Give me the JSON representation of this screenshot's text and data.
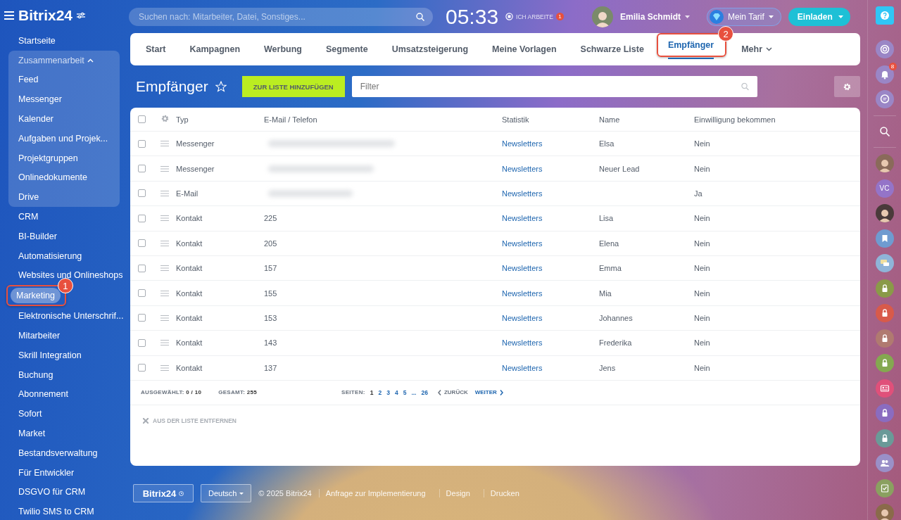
{
  "sidebar": {
    "logo": "Bitrix24",
    "items": [
      {
        "label": "Startseite",
        "kind": "link",
        "selected": false
      },
      {
        "label": "Zusammenarbeit",
        "kind": "group",
        "selected": false,
        "expanded": true,
        "children": [
          {
            "label": "Feed",
            "selected": false
          },
          {
            "label": "Messenger",
            "selected": false
          },
          {
            "label": "Kalender",
            "selected": false
          },
          {
            "label": "Aufgaben und Projek...",
            "selected": false
          },
          {
            "label": "Projektgruppen",
            "selected": false
          },
          {
            "label": "Onlinedokumente",
            "selected": false
          },
          {
            "label": "Drive",
            "selected": false
          }
        ]
      },
      {
        "label": "CRM",
        "kind": "link",
        "selected": false
      },
      {
        "label": "BI-Builder",
        "kind": "link",
        "selected": false
      },
      {
        "label": "Automatisierung",
        "kind": "link",
        "selected": false
      },
      {
        "label": "Websites und Onlineshops",
        "kind": "link",
        "selected": false
      },
      {
        "label": "Marketing",
        "kind": "link",
        "selected": true,
        "callout": "1"
      },
      {
        "label": "Elektronische Unterschrif...",
        "kind": "link",
        "selected": false
      },
      {
        "label": "Mitarbeiter",
        "kind": "link",
        "selected": false
      },
      {
        "label": "Skrill Integration",
        "kind": "link",
        "selected": false
      },
      {
        "label": "Buchung",
        "kind": "link",
        "selected": false
      },
      {
        "label": "Abonnement",
        "kind": "link",
        "selected": false
      },
      {
        "label": "Sofort",
        "kind": "link",
        "selected": false
      },
      {
        "label": "Market",
        "kind": "link",
        "selected": false
      },
      {
        "label": "Bestandsverwaltung",
        "kind": "link",
        "selected": false
      },
      {
        "label": "Für Entwickler",
        "kind": "link",
        "selected": false
      },
      {
        "label": "DSGVO für CRM",
        "kind": "link",
        "selected": false
      },
      {
        "label": "Twilio SMS to CRM",
        "kind": "link",
        "selected": false
      }
    ]
  },
  "header": {
    "search_placeholder": "Suchen nach: Mitarbeiter, Datei, Sonstiges...",
    "clock": "05:33",
    "work_status": "ICH ARBEITE",
    "work_badge": "1",
    "user": "Emilia Schmidt",
    "plan_button": "Mein Tarif",
    "invite_button": "Einladen"
  },
  "tabs": [
    {
      "label": "Start",
      "kind": "tab",
      "selected": false
    },
    {
      "label": "Kampagnen",
      "kind": "tab",
      "selected": false
    },
    {
      "label": "Werbung",
      "kind": "tab",
      "selected": false
    },
    {
      "label": "Segmente",
      "kind": "tab",
      "selected": false
    },
    {
      "label": "Umsatzsteigerung",
      "kind": "tab",
      "selected": false
    },
    {
      "label": "Meine Vorlagen",
      "kind": "tab",
      "selected": false
    },
    {
      "label": "Schwarze Liste",
      "kind": "tab",
      "selected": false
    },
    {
      "label": "Empfänger",
      "kind": "tab",
      "selected": true,
      "callout": "2"
    },
    {
      "label": "Mehr",
      "kind": "menu",
      "selected": false
    }
  ],
  "page": {
    "title": "Empfänger",
    "add_button": "ZUR LISTE HINZUFÜGEN",
    "filter_placeholder": "Filter"
  },
  "table": {
    "select_all_checked": false,
    "columns": [
      "Typ",
      "E-Mail / Telefon",
      "Statistik",
      "Name",
      "Einwilligung bekommen"
    ],
    "rows": [
      {
        "checked": false,
        "type": "Messenger",
        "contact_hidden": true,
        "statistics": "Newsletters",
        "name": "Elsa",
        "consent": "Nein"
      },
      {
        "checked": false,
        "type": "Messenger",
        "contact_hidden": true,
        "statistics": "Newsletters",
        "name": "Neuer Lead",
        "consent": "Nein"
      },
      {
        "checked": false,
        "type": "E-Mail",
        "contact_hidden": true,
        "statistics": "Newsletters",
        "consent": "Ja"
      },
      {
        "checked": false,
        "type": "Kontakt",
        "contact_hidden": false,
        "contact": "225",
        "statistics": "Newsletters",
        "name": "Lisa",
        "consent": "Nein"
      },
      {
        "checked": false,
        "type": "Kontakt",
        "contact_hidden": false,
        "contact": "205",
        "statistics": "Newsletters",
        "name": "Elena",
        "consent": "Nein"
      },
      {
        "checked": false,
        "type": "Kontakt",
        "contact_hidden": false,
        "contact": "157",
        "statistics": "Newsletters",
        "name": "Emma",
        "consent": "Nein"
      },
      {
        "checked": false,
        "type": "Kontakt",
        "contact_hidden": false,
        "contact": "155",
        "statistics": "Newsletters",
        "name": "Mia",
        "consent": "Nein"
      },
      {
        "checked": false,
        "type": "Kontakt",
        "contact_hidden": false,
        "contact": "153",
        "statistics": "Newsletters",
        "name": "Johannes",
        "consent": "Nein"
      },
      {
        "checked": false,
        "type": "Kontakt",
        "contact_hidden": false,
        "contact": "143",
        "statistics": "Newsletters",
        "name": "Frederika",
        "consent": "Nein"
      },
      {
        "checked": false,
        "type": "Kontakt",
        "contact_hidden": false,
        "contact": "137",
        "statistics": "Newsletters",
        "name": "Jens",
        "consent": "Nein"
      }
    ],
    "summary": {
      "selected_label": "AUSGEWÄHLT:",
      "selected_value": "0 / 10",
      "total_label": "GESAMT:",
      "total_value": "255",
      "pages_label": "SEITEN:",
      "pages": [
        {
          "label": "1",
          "selected": true
        },
        {
          "label": "2",
          "selected": false
        },
        {
          "label": "3",
          "selected": false
        },
        {
          "label": "4",
          "selected": false
        },
        {
          "label": "5",
          "selected": false
        },
        {
          "label": "...",
          "selected": false
        },
        {
          "label": "26",
          "selected": false
        }
      ],
      "prev": "ZURÜCK",
      "next": "WEITER"
    },
    "remove_action": "AUS DER LISTE ENTFERNEN"
  },
  "footer": {
    "logo": "Bitrix24",
    "language": "Deutsch",
    "copyright": "© 2025 Bitrix24",
    "links": [
      "Anfrage zur Implementierung",
      "Design",
      "Drucken"
    ]
  },
  "rail": [
    {
      "kind": "help",
      "color": "#2fc6f6"
    },
    {
      "kind": "copilot",
      "color": "#9a86c6"
    },
    {
      "kind": "bell",
      "color": "#9a86c6",
      "badge": "8"
    },
    {
      "kind": "chat",
      "color": "#9a86c6"
    },
    {
      "kind": "search"
    },
    {
      "kind": "avatar",
      "color": "#8a6a5a"
    },
    {
      "kind": "initials",
      "color": "#9474c8",
      "text": "VC"
    },
    {
      "kind": "avatar",
      "color": "#4a3a3a"
    },
    {
      "kind": "bookmark",
      "color": "#6f9bd0"
    },
    {
      "kind": "messages",
      "color": "#8fb4d8"
    },
    {
      "kind": "lock",
      "color": "#8a9a48"
    },
    {
      "kind": "lock",
      "color": "#d85a4a"
    },
    {
      "kind": "lock",
      "color": "#b07a70"
    },
    {
      "kind": "lock",
      "color": "#84a850"
    },
    {
      "kind": "card",
      "color": "#e0507a"
    },
    {
      "kind": "lock",
      "color": "#8a6cc0"
    },
    {
      "kind": "lock",
      "color": "#6a9a98"
    },
    {
      "kind": "people",
      "color": "#9a90c8"
    },
    {
      "kind": "tasks",
      "color": "#8aa060"
    },
    {
      "kind": "avatar",
      "color": "#8a6a4a"
    }
  ]
}
